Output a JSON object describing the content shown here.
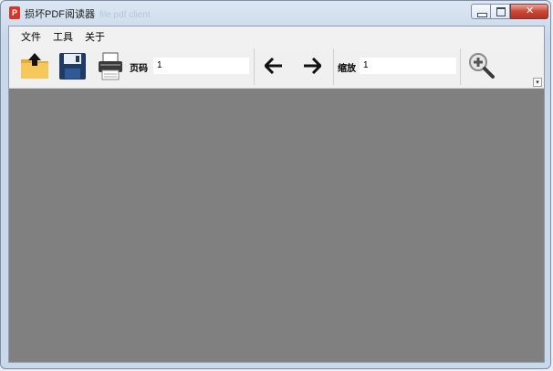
{
  "window": {
    "title": "损坏PDF阅读器",
    "app_icon_text": "PDF",
    "background_titles": [
      "file.pdf client",
      ""
    ]
  },
  "menu": {
    "items": [
      {
        "label": "文件"
      },
      {
        "label": "工具"
      },
      {
        "label": "关于"
      }
    ]
  },
  "toolbar": {
    "page_label": "页码",
    "page_value": "1",
    "zoom_label": "缩放",
    "zoom_value": "1",
    "icons": [
      "open-folder-icon",
      "save-icon",
      "print-icon",
      "arrow-left-icon",
      "arrow-right-icon",
      "zoom-in-icon"
    ]
  },
  "colors": {
    "viewer_background": "#808080",
    "toolbar_background": "#f0f0f0",
    "menubar_background": "#f1f1f1",
    "close_button": "#c8483a"
  }
}
